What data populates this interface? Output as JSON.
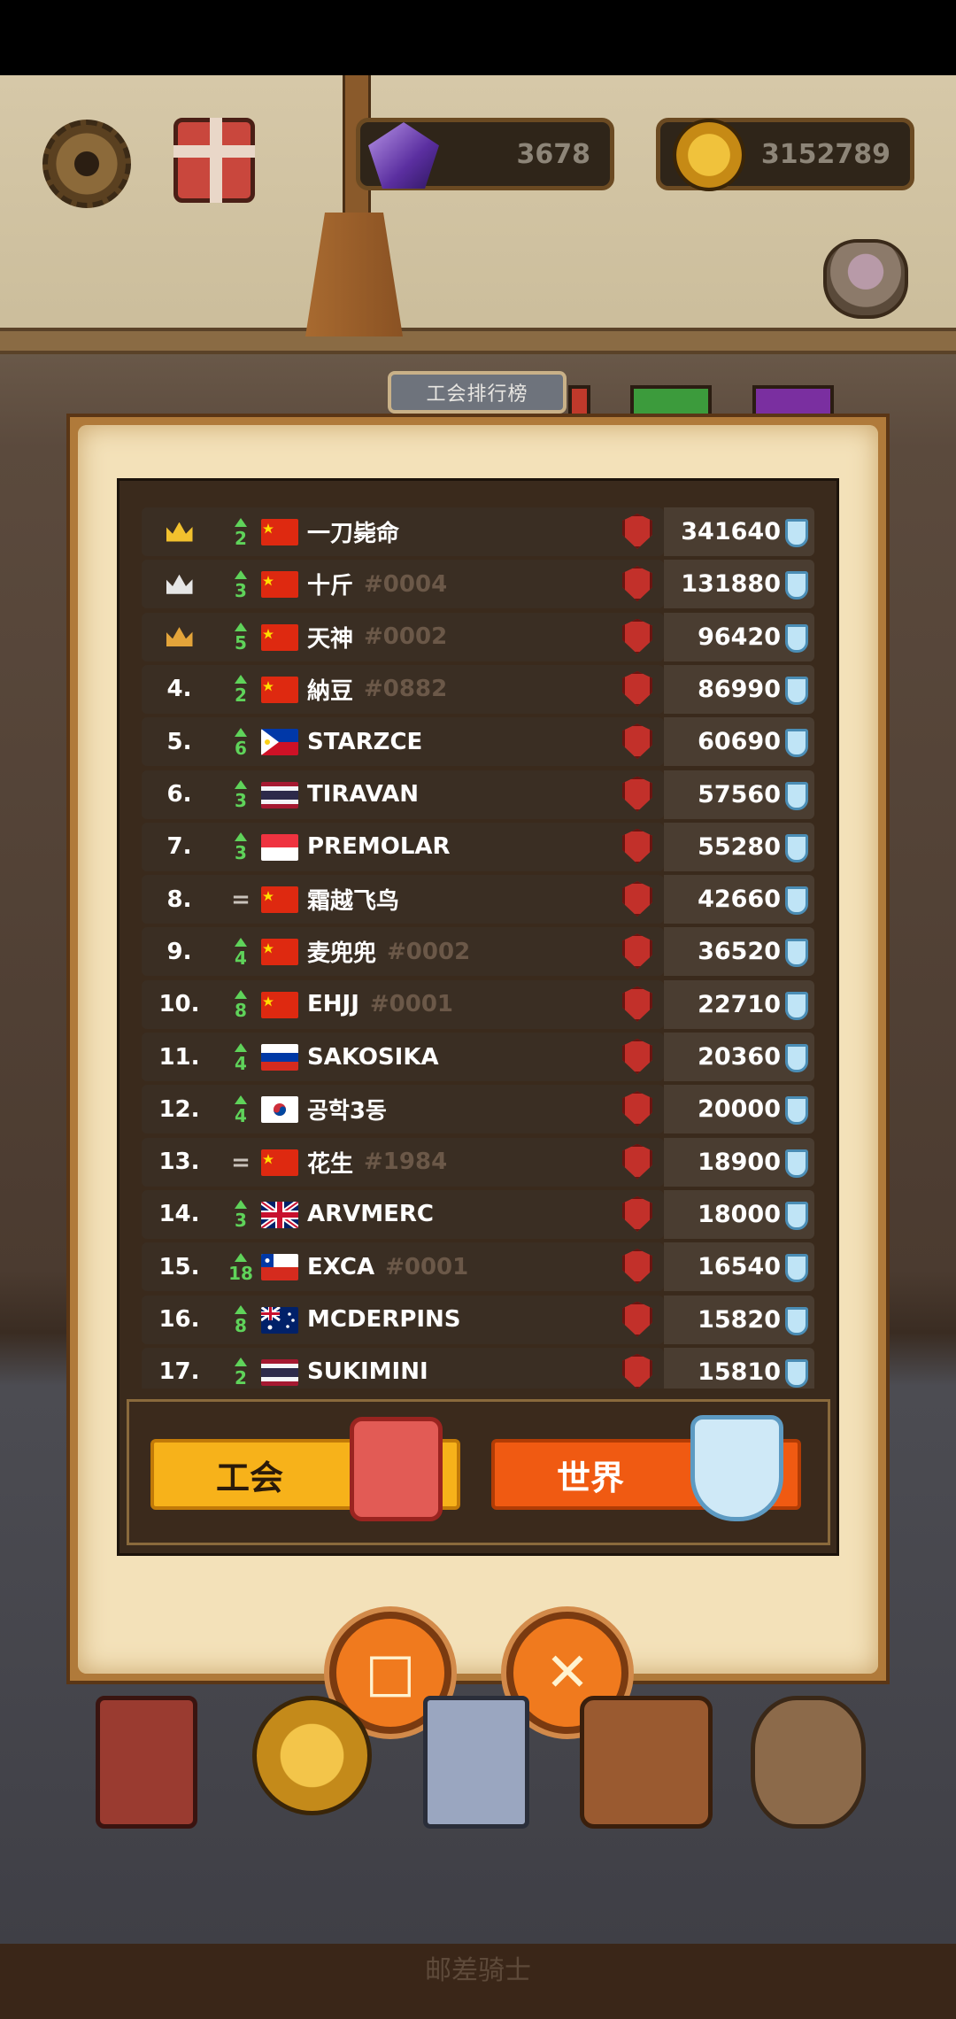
{
  "currencies": {
    "gems": "3678",
    "coins": "3152789"
  },
  "board": {
    "title": "工会排行榜"
  },
  "rows": [
    {
      "rank": "",
      "crown": "gold",
      "change": "2",
      "dir": "up",
      "country": "cn",
      "name": "一刀毙命",
      "tag": "",
      "score": "341640"
    },
    {
      "rank": "",
      "crown": "silver",
      "change": "3",
      "dir": "up",
      "country": "cn",
      "name": "十斤",
      "tag": "#0004",
      "score": "131880"
    },
    {
      "rank": "",
      "crown": "bronze",
      "change": "5",
      "dir": "up",
      "country": "cn",
      "name": "天神",
      "tag": "#0002",
      "score": "96420"
    },
    {
      "rank": "4.",
      "crown": "",
      "change": "2",
      "dir": "up",
      "country": "cn",
      "name": "納豆",
      "tag": "#0882",
      "score": "86990"
    },
    {
      "rank": "5.",
      "crown": "",
      "change": "6",
      "dir": "up",
      "country": "ph",
      "name": "STARZCE",
      "tag": "",
      "score": "60690"
    },
    {
      "rank": "6.",
      "crown": "",
      "change": "3",
      "dir": "up",
      "country": "th",
      "name": "TIRAVAN",
      "tag": "",
      "score": "57560"
    },
    {
      "rank": "7.",
      "crown": "",
      "change": "3",
      "dir": "up",
      "country": "sg",
      "name": "PREMOLAR",
      "tag": "",
      "score": "55280"
    },
    {
      "rank": "8.",
      "crown": "",
      "change": "=",
      "dir": "same",
      "country": "cn",
      "name": "霜越飞鸟",
      "tag": "",
      "score": "42660"
    },
    {
      "rank": "9.",
      "crown": "",
      "change": "4",
      "dir": "up",
      "country": "cn",
      "name": "麦兜兜",
      "tag": "#0002",
      "score": "36520"
    },
    {
      "rank": "10.",
      "crown": "",
      "change": "8",
      "dir": "up",
      "country": "cn",
      "name": "EHJJ",
      "tag": "#0001",
      "score": "22710"
    },
    {
      "rank": "11.",
      "crown": "",
      "change": "4",
      "dir": "up",
      "country": "ru",
      "name": "SAKOSIKA",
      "tag": "",
      "score": "20360"
    },
    {
      "rank": "12.",
      "crown": "",
      "change": "4",
      "dir": "up",
      "country": "kr",
      "name": "공학3동",
      "tag": "",
      "score": "20000"
    },
    {
      "rank": "13.",
      "crown": "",
      "change": "=",
      "dir": "same",
      "country": "cn",
      "name": "花生",
      "tag": "#1984",
      "score": "18900"
    },
    {
      "rank": "14.",
      "crown": "",
      "change": "3",
      "dir": "up",
      "country": "gb",
      "name": "ARVMERC",
      "tag": "",
      "score": "18000"
    },
    {
      "rank": "15.",
      "crown": "",
      "change": "18",
      "dir": "up",
      "country": "cl",
      "name": "EXCA",
      "tag": "#0001",
      "score": "16540"
    },
    {
      "rank": "16.",
      "crown": "",
      "change": "8",
      "dir": "up",
      "country": "au",
      "name": "MCDERPINS",
      "tag": "",
      "score": "15820"
    },
    {
      "rank": "17.",
      "crown": "",
      "change": "2",
      "dir": "up",
      "country": "th",
      "name": "SUKIMINI",
      "tag": "",
      "score": "15810"
    }
  ],
  "tabs": {
    "guild": "工会",
    "world": "世界"
  },
  "footer": "邮差骑士",
  "colors": {
    "crown_gold": "#f2c12e",
    "crown_silver": "#e6e6e6",
    "crown_bronze": "#e3a43a",
    "up_green": "#5fd35a"
  }
}
